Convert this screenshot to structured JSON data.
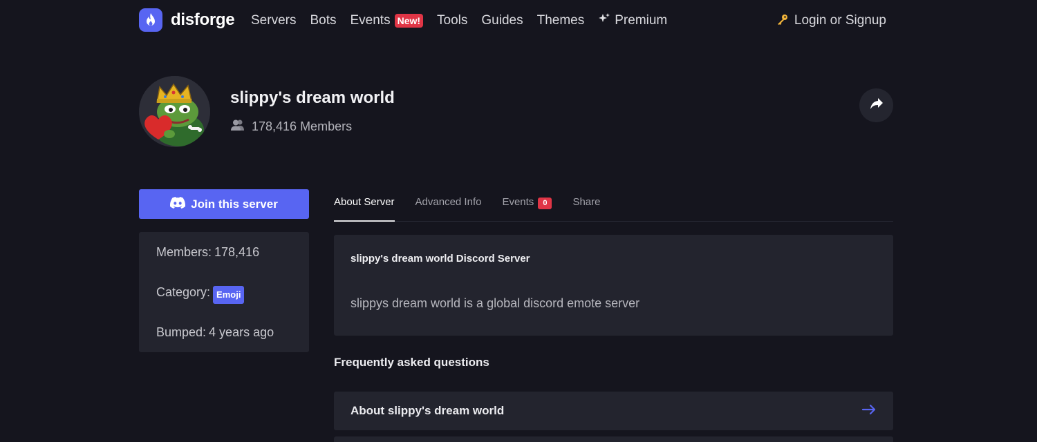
{
  "nav": {
    "brand": "disforge",
    "links": [
      {
        "label": "Servers"
      },
      {
        "label": "Bots"
      },
      {
        "label": "Events",
        "badge": "New!"
      },
      {
        "label": "Tools"
      },
      {
        "label": "Guides"
      },
      {
        "label": "Themes"
      },
      {
        "label": "Premium",
        "icon": "sparkles-icon"
      }
    ],
    "login_label": "Login or Signup",
    "login_icon": "key-icon"
  },
  "server": {
    "name": "slippy's dream world",
    "members_text": "178,416 Members",
    "avatar_icon": "crowned-frog-avatar"
  },
  "sidebar": {
    "join_label": "Join this server",
    "members_label": "Members:",
    "members_value": "178,416",
    "category_label": "Category:",
    "category_value": "Emoji",
    "bumped_label": "Bumped:",
    "bumped_value": "4 years ago"
  },
  "tabs": [
    {
      "label": "About Server",
      "active": true
    },
    {
      "label": "Advanced Info"
    },
    {
      "label": "Events",
      "count": "0"
    },
    {
      "label": "Share"
    }
  ],
  "about": {
    "title": "slippy's dream world Discord Server",
    "description": "slippys dream world is a global discord emote server"
  },
  "faq": {
    "heading": "Frequently asked questions",
    "items": [
      {
        "label": "About slippy's dream world"
      }
    ]
  },
  "colors": {
    "background": "#15151e",
    "card": "#23242e",
    "accent": "#5865f2",
    "badge_red": "#e03546"
  }
}
